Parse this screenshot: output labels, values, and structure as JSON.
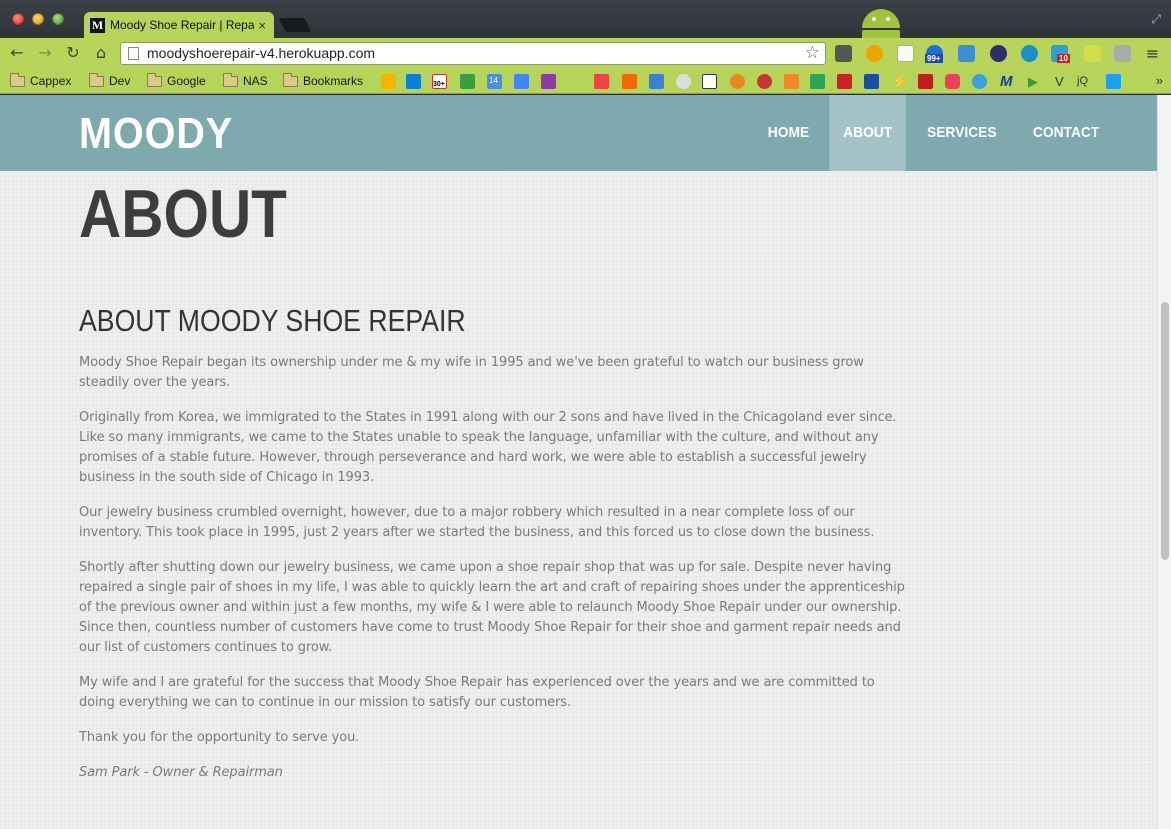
{
  "browser": {
    "tab_title": "Moody Shoe Repair | Repair",
    "tab_favicon_letter": "M",
    "url": "moodyshoerepair-v4.herokuapp.com",
    "bookmarks": [
      "Cappex",
      "Dev",
      "Google",
      "NAS",
      "Bookmarks"
    ],
    "bookmark_icon_labels": [
      "30+",
      "14",
      "jQ"
    ],
    "extension_badges": [
      "99+",
      "10"
    ]
  },
  "site": {
    "logo": "MOODY",
    "nav": [
      "HOME",
      "ABOUT",
      "SERVICES",
      "CONTACT"
    ],
    "active_nav": "ABOUT",
    "page_heading": "ABOUT",
    "section_title": "ABOUT MOODY SHOE REPAIR",
    "paragraphs": [
      "Moody Shoe Repair began its ownership under me & my wife in 1995 and we've been grateful to watch our business grow steadily over the years.",
      "Originally from Korea, we immigrated to the States in 1991 along with our 2 sons and have lived in the Chicagoland ever since. Like so many immigrants, we came to the States unable to speak the language, unfamiliar with the culture, and without any promises of a stable future. However, through perseverance and hard work, we were able to establish a successful jewelry business in the south side of Chicago in 1993.",
      "Our jewelry business crumbled overnight, however, due to a major robbery which resulted in a near complete loss of our inventory. This took place in 1995, just 2 years after we started the business, and this forced us to close down the business.",
      "Shortly after shutting down our jewelry business, we came upon a shoe repair shop that was up for sale. Despite never having repaired a single pair of shoes in my life, I was able to quickly learn the art and craft of repairing shoes under the apprenticeship of the previous owner and within just a few months, my wife & I were able to relaunch Moody Shoe Repair under our ownership. Since then, countless number of customers have come to trust Moody Shoe Repair for their shoe and garment repair needs and our list of customers continues to grow.",
      "My wife and I are grateful for the success that Moody Shoe Repair has experienced over the years and we are committed to doing everything we can to continue in our mission to satisfy our customers.",
      "Thank you for the opportunity to serve you."
    ],
    "signature": "Sam Park - Owner & Repairman"
  },
  "colors": {
    "header_bg": "#7ea9ae",
    "nav_active_bg": "#a5c3c6",
    "chrome_green": "#b8d45a",
    "body_text": "#7a7a7a",
    "heading_text": "#3d3d3d"
  }
}
